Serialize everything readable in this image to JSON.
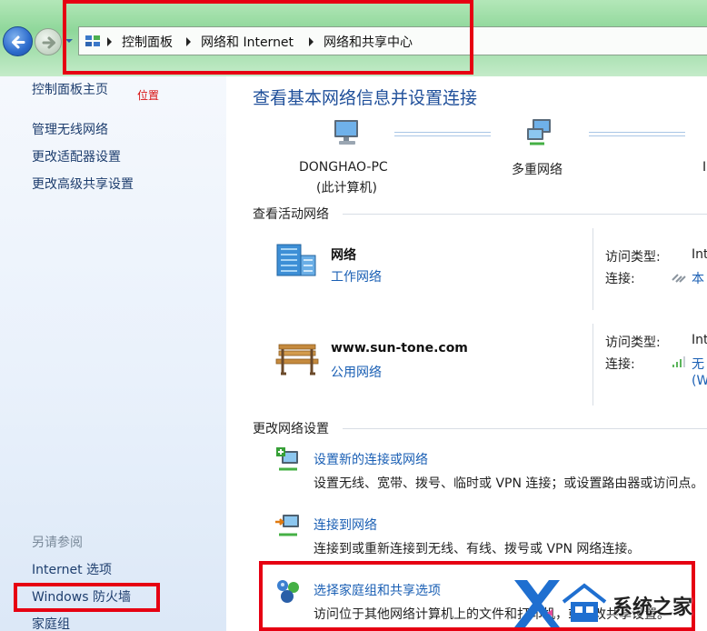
{
  "breadcrumb": [
    "控制面板",
    "网络和 Internet",
    "网络和共享中心"
  ],
  "sidebar": {
    "home": "控制面板主页",
    "annotation": "位置",
    "links": [
      "管理无线网络",
      "更改适配器设置",
      "更改高级共享设置"
    ],
    "see_also_heading": "另请参阅",
    "see_also": [
      "Internet 选项",
      "Windows 防火墙",
      "家庭组"
    ]
  },
  "main": {
    "title": "查看基本网络信息并设置连接",
    "map": {
      "computer_name": "DONGHAO-PC",
      "computer_sub": "(此计算机)",
      "network": "多重网络",
      "third_partial": "I"
    },
    "active_heading": "查看活动网络",
    "networks": [
      {
        "name": "网络",
        "type": "工作网络",
        "access_label": "访问类型:",
        "access_value": "Int",
        "connection_label": "连接:",
        "connection_value": "本",
        "connection_extra": ""
      },
      {
        "name": "www.sun-tone.com",
        "type": "公用网络",
        "access_label": "访问类型:",
        "access_value": "Int",
        "connection_label": "连接:",
        "connection_value": "无",
        "connection_extra": "(W"
      }
    ],
    "change_heading": "更改网络设置",
    "tasks": [
      {
        "title": "设置新的连接或网络",
        "desc": "设置无线、宽带、拨号、临时或 VPN 连接；或设置路由器或访问点。",
        "icon": "new-connection-icon"
      },
      {
        "title": "连接到网络",
        "desc": "连接到或重新连接到无线、有线、拨号或 VPN 网络连接。",
        "icon": "connect-network-icon"
      },
      {
        "title": "选择家庭组和共享选项",
        "desc": "访问位于其他网络计算机上的文件和打印机，或更改共享设置。",
        "icon": "homegroup-icon"
      }
    ]
  },
  "watermark": {
    "text": "系统之家",
    "letter": "X"
  },
  "colors": {
    "link": "#1a5fb4",
    "title": "#1f4f9a",
    "annotation_red": "#e60012",
    "sidebar_link": "#1e3e6e"
  }
}
